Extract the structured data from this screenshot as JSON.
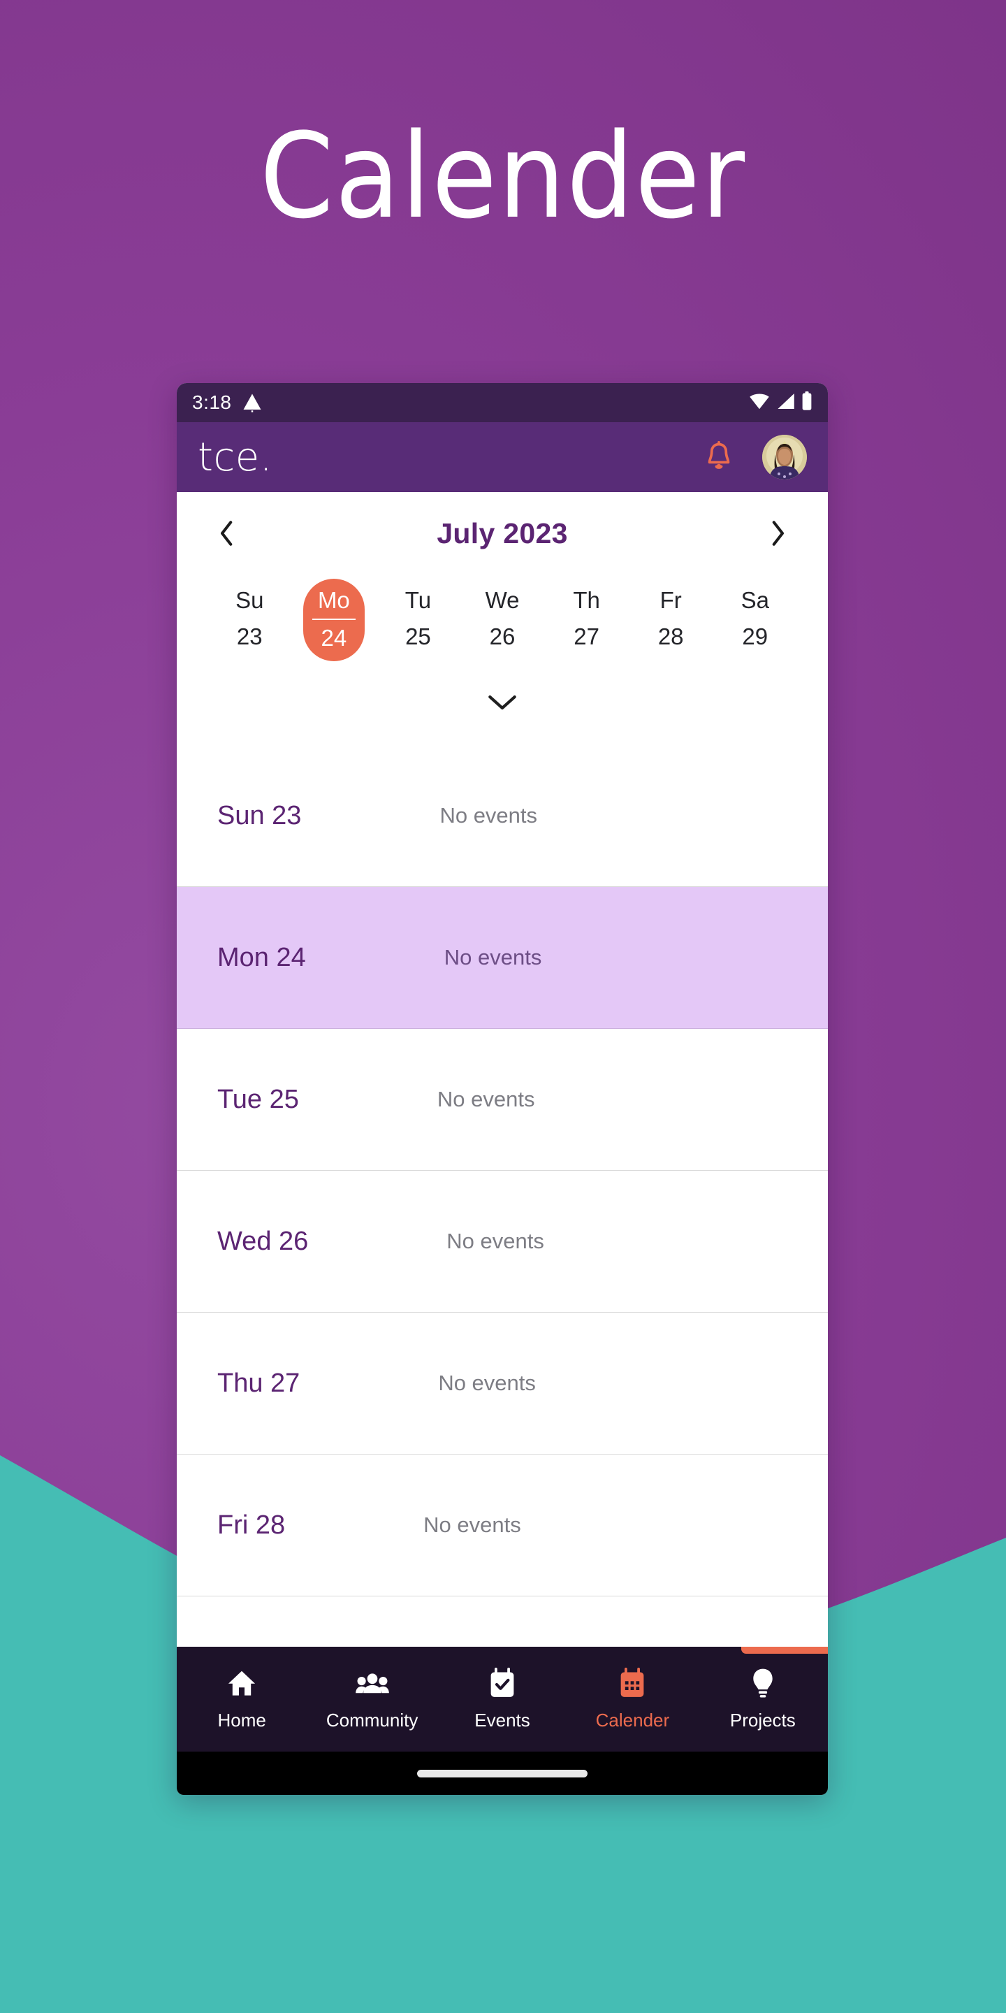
{
  "hero": {
    "title": "Calender"
  },
  "colors": {
    "page_purple": "#8a3d96",
    "teal_wave": "#45bdb4",
    "statusbar_purple": "#3b2150",
    "appbar_purple": "#582c77",
    "accent_orange": "#ec6b4e",
    "brand_purple": "#5b2472",
    "highlight_lavender": "#e4c8f7",
    "bottomnav_dark": "#1d1229"
  },
  "statusbar": {
    "time": "3:18",
    "warning_icon": "warning-triangle-icon",
    "right_icons": [
      "wifi-icon",
      "cellular-signal-icon",
      "battery-icon"
    ]
  },
  "appbar": {
    "brand": "tce.",
    "bell_icon": "notification-bell-icon",
    "avatar_icon": "user-avatar"
  },
  "calendar": {
    "prev_icon": "chevron-left-icon",
    "next_icon": "chevron-right-icon",
    "month_label": "July 2023",
    "expand_icon": "chevron-down-icon",
    "week": [
      {
        "dow": "Su",
        "day": "23",
        "selected": false
      },
      {
        "dow": "Mo",
        "day": "24",
        "selected": true
      },
      {
        "dow": "Tu",
        "day": "25",
        "selected": false
      },
      {
        "dow": "We",
        "day": "26",
        "selected": false
      },
      {
        "dow": "Th",
        "day": "27",
        "selected": false
      },
      {
        "dow": "Fr",
        "day": "28",
        "selected": false
      },
      {
        "dow": "Sa",
        "day": "29",
        "selected": false
      }
    ]
  },
  "agenda": {
    "rows": [
      {
        "date": "Sun 23",
        "status": "No events",
        "highlight": false
      },
      {
        "date": "Mon 24",
        "status": "No events",
        "highlight": true
      },
      {
        "date": "Tue 25",
        "status": "No events",
        "highlight": false
      },
      {
        "date": "Wed 26",
        "status": "No events",
        "highlight": false
      },
      {
        "date": "Thu 27",
        "status": "No events",
        "highlight": false
      },
      {
        "date": "Fri 28",
        "status": "No events",
        "highlight": false
      }
    ]
  },
  "bottomnav": {
    "items": [
      {
        "label": "Home",
        "icon": "home-icon",
        "active": false
      },
      {
        "label": "Community",
        "icon": "people-group-icon",
        "active": false
      },
      {
        "label": "Events",
        "icon": "calendar-check-icon",
        "active": false
      },
      {
        "label": "Calender",
        "icon": "calendar-grid-icon",
        "active": true
      },
      {
        "label": "Projects",
        "icon": "lightbulb-icon",
        "active": false
      }
    ]
  }
}
